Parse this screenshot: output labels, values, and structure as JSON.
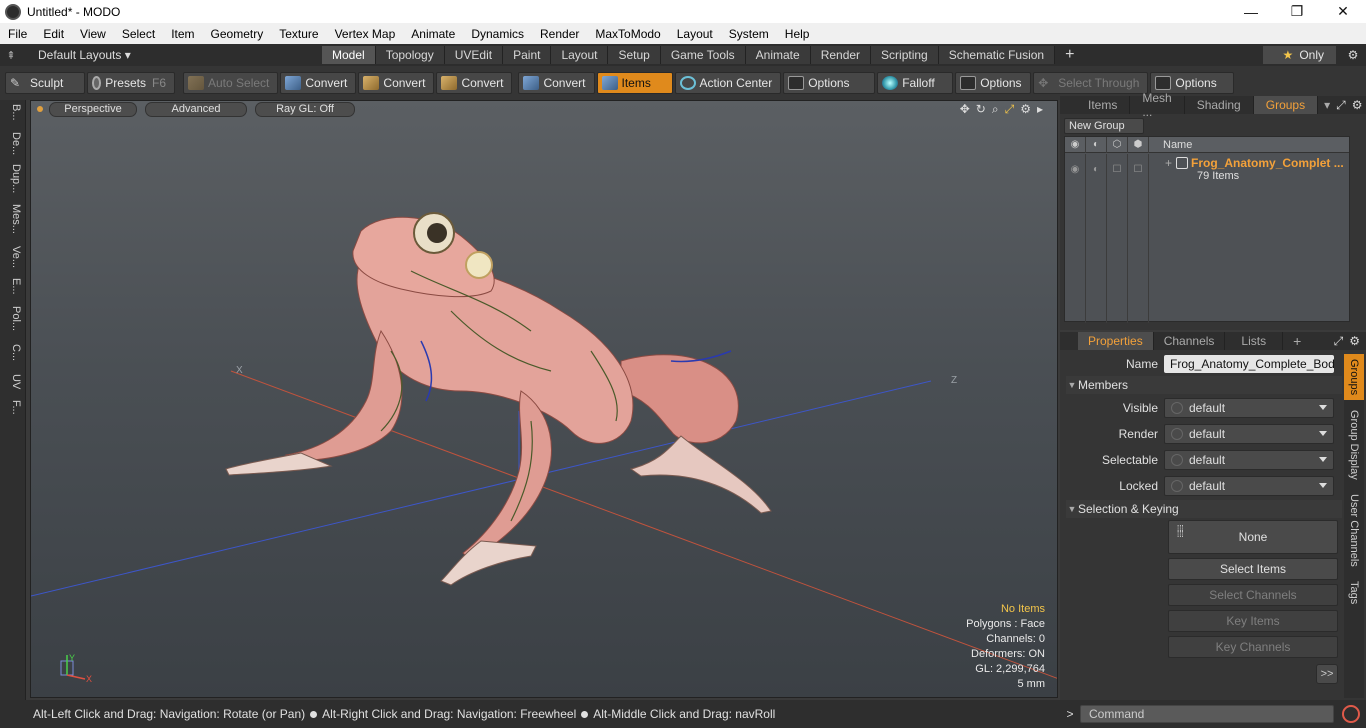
{
  "window": {
    "title": "Untitled* - MODO",
    "min": "—",
    "max": "❐",
    "close": "✕"
  },
  "menu": [
    "File",
    "Edit",
    "View",
    "Select",
    "Item",
    "Geometry",
    "Texture",
    "Vertex Map",
    "Animate",
    "Dynamics",
    "Render",
    "MaxToModo",
    "Layout",
    "System",
    "Help"
  ],
  "layoutbar": {
    "layouts_label": "Default Layouts ▾",
    "tabs": [
      "Model",
      "Topology",
      "UVEdit",
      "Paint",
      "Layout",
      "Setup",
      "Game Tools",
      "Animate",
      "Render",
      "Scripting",
      "Schematic Fusion"
    ],
    "active_tab": "Model",
    "add": "+",
    "only_label": "Only"
  },
  "toolbar": {
    "sculpt": "Sculpt",
    "presets": "Presets",
    "presets_key": "F6",
    "auto_select": "Auto Select",
    "convert1": "Convert",
    "convert2": "Convert",
    "convert3": "Convert",
    "convert4": "Convert",
    "items": "Items",
    "action_center": "Action Center",
    "options1": "Options",
    "falloff": "Falloff",
    "options2": "Options",
    "select_through": "Select Through",
    "options3": "Options"
  },
  "left_tabs": [
    "B...",
    "De...",
    "Dup...",
    "Mes...",
    "Ve...",
    "E...",
    "Pol...",
    "C...",
    "UV",
    "F..."
  ],
  "viewport": {
    "view_mode": "Perspective",
    "advanced": "Advanced",
    "raygl": "Ray GL: Off",
    "info": {
      "no_items": "No Items",
      "polygons": "Polygons : Face",
      "channels": "Channels: 0",
      "deformers": "Deformers: ON",
      "gl": "GL: 2,299,764",
      "grid": "5 mm"
    },
    "axis_x": "X",
    "axis_y": "Y",
    "axis_z": "Z"
  },
  "status": {
    "hint1": "Alt-Left Click and Drag: Navigation: Rotate (or Pan)",
    "hint2": "Alt-Right Click and Drag: Navigation: Freewheel",
    "hint3": "Alt-Middle Click and Drag: navRoll",
    "command_placeholder": "Command",
    "chev": ">"
  },
  "groups_panel": {
    "tabs": [
      "Items",
      "Mesh ...",
      "Shading",
      "Groups"
    ],
    "active_tab": "Groups",
    "new_group": "New Group",
    "col_name": "Name",
    "group_name": "Frog_Anatomy_Complet ...",
    "group_count": "79 Items"
  },
  "properties_panel": {
    "tabs": [
      "Properties",
      "Channels",
      "Lists"
    ],
    "active_tab": "Properties",
    "add": "+",
    "name_label": "Name",
    "name_value": "Frog_Anatomy_Complete_Body (",
    "members_section": "Members",
    "visible_label": "Visible",
    "visible_value": "default",
    "render_label": "Render",
    "render_value": "default",
    "selectable_label": "Selectable",
    "selectable_value": "default",
    "locked_label": "Locked",
    "locked_value": "default",
    "selection_section": "Selection & Keying",
    "none_btn": "None",
    "select_items": "Select Items",
    "select_channels": "Select Channels",
    "key_items": "Key Items",
    "key_channels": "Key Channels",
    "more": ">>",
    "side_tabs": [
      "Groups",
      "Group Display",
      "User Channels",
      "Tags"
    ]
  },
  "colors": {
    "accent": "#e08a1c",
    "highlight_text": "#f3a13a",
    "info_warn": "#f3c54a"
  }
}
